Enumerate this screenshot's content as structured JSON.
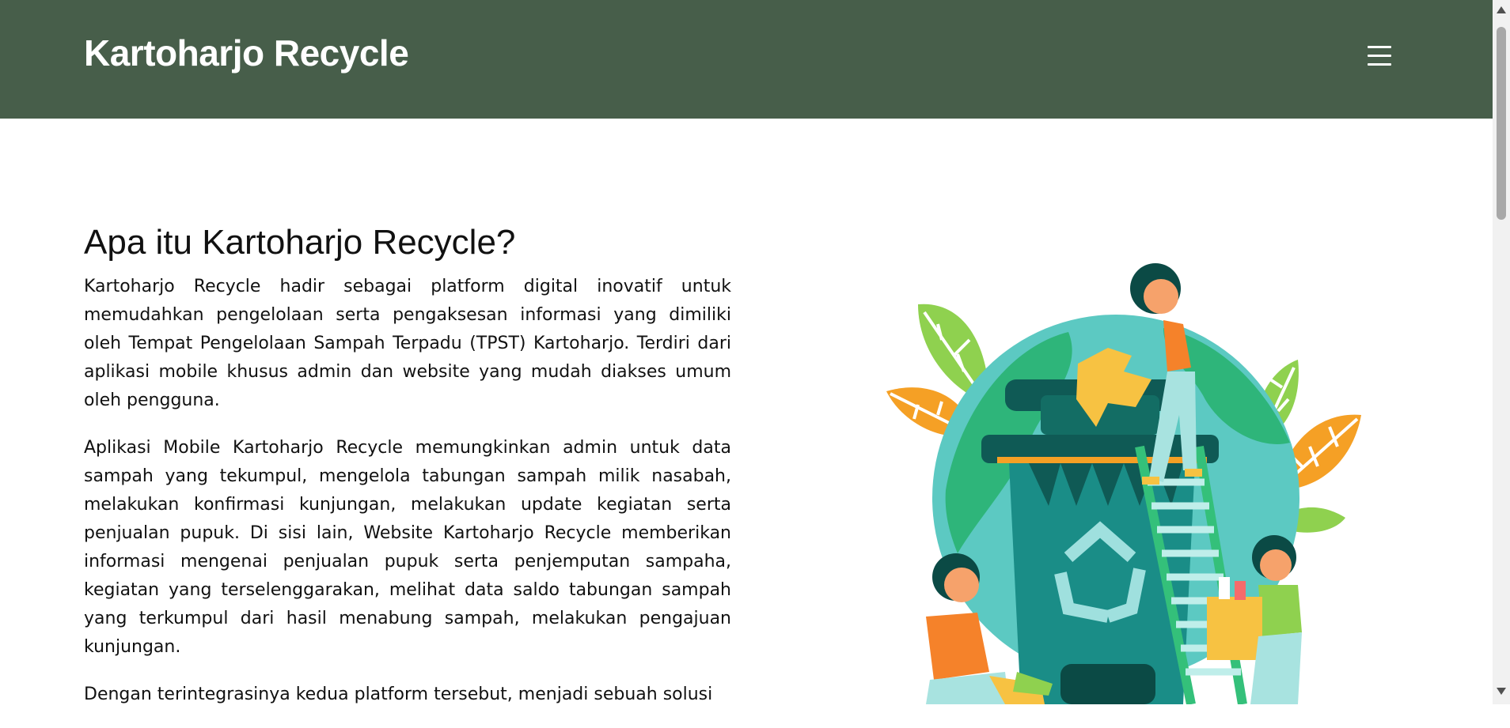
{
  "navbar": {
    "brand": "Kartoharjo Recycle",
    "menu_icon": "hamburger-menu-icon",
    "bg_color": "#475e4a"
  },
  "about": {
    "title": "Apa itu Kartoharjo Recycle?",
    "paragraphs": [
      "Kartoharjo Recycle hadir sebagai platform digital inovatif untuk memudahkan pengelolaan serta pengaksesan informasi yang dimiliki oleh Tempat Pengelolaan Sampah Terpadu (TPST) Kartoharjo. Terdiri dari aplikasi mobile khusus admin dan website yang mudah diakses umum oleh pengguna.",
      "Aplikasi Mobile Kartoharjo Recycle memungkinkan admin untuk data sampah yang tekumpul, mengelola tabungan sampah milik nasabah, melakukan konfirmasi kunjungan, melakukan update kegiatan serta penjualan pupuk. Di sisi lain, Website Kartoharjo Recycle memberikan informasi mengenai penjualan pupuk serta penjemputan sampaha, kegiatan yang terselenggarakan, melihat data saldo tabungan sampah yang terkumpul dari hasil menabung sampah, melakukan pengajuan kunjungan.",
      "Dengan terintegrasinya kedua platform tersebut, menjadi sebuah solusi"
    ],
    "illustration": "recycling-illustration"
  }
}
